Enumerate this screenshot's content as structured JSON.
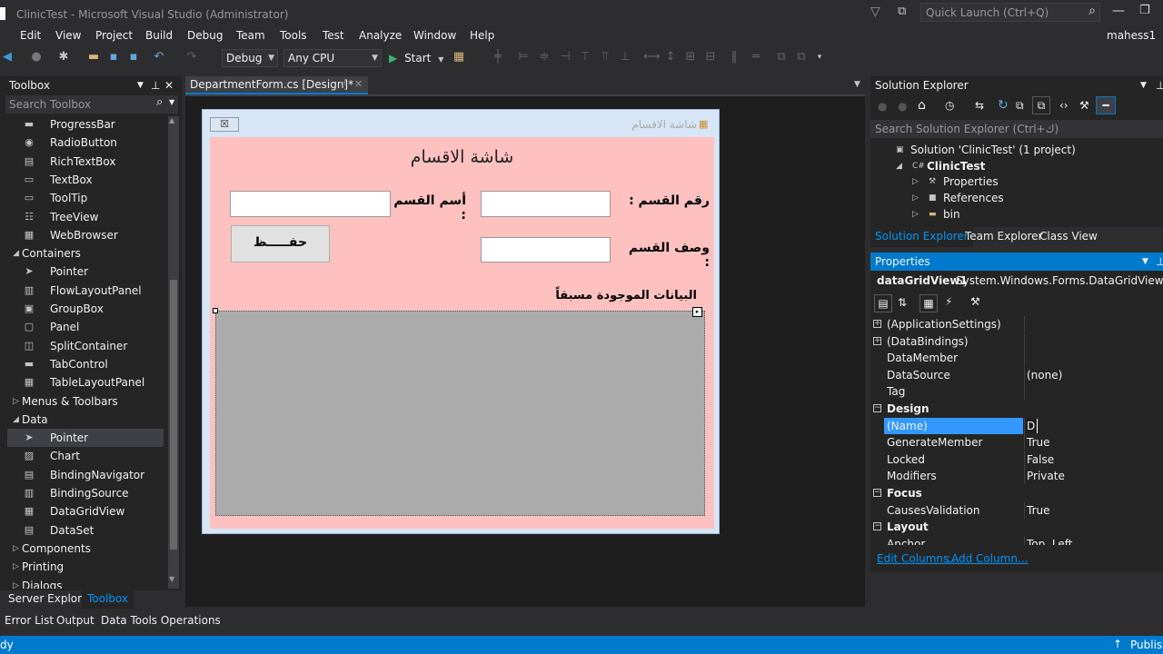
{
  "window": {
    "title": "ClinicTest - Microsoft Visual Studio (Administrator)",
    "quick_launch": "Quick Launch (Ctrl+Q)",
    "user": "mahess1"
  },
  "menu": [
    "Edit",
    "View",
    "Project",
    "Build",
    "Debug",
    "Team",
    "Tools",
    "Test",
    "Analyze",
    "Window",
    "Help"
  ],
  "toolbar": {
    "config": "Debug",
    "platform": "Any CPU",
    "start": "Start"
  },
  "toolbox": {
    "title": "Toolbox",
    "search_placeholder": "Search Toolbox",
    "items": [
      {
        "label": "ProgressBar",
        "kind": "item",
        "icon": "progressbar-icon"
      },
      {
        "label": "RadioButton",
        "kind": "item",
        "icon": "radiobutton-icon"
      },
      {
        "label": "RichTextBox",
        "kind": "item",
        "icon": "richtextbox-icon"
      },
      {
        "label": "TextBox",
        "kind": "item",
        "icon": "textbox-icon"
      },
      {
        "label": "ToolTip",
        "kind": "item",
        "icon": "tooltip-icon"
      },
      {
        "label": "TreeView",
        "kind": "item",
        "icon": "treeview-icon"
      },
      {
        "label": "WebBrowser",
        "kind": "item",
        "icon": "webbrowser-icon"
      },
      {
        "label": "Containers",
        "kind": "cat-open"
      },
      {
        "label": "Pointer",
        "kind": "item",
        "icon": "pointer-icon"
      },
      {
        "label": "FlowLayoutPanel",
        "kind": "item",
        "icon": "flowlayoutpanel-icon"
      },
      {
        "label": "GroupBox",
        "kind": "item",
        "icon": "groupbox-icon"
      },
      {
        "label": "Panel",
        "kind": "item",
        "icon": "panel-icon"
      },
      {
        "label": "SplitContainer",
        "kind": "item",
        "icon": "splitcontainer-icon"
      },
      {
        "label": "TabControl",
        "kind": "item",
        "icon": "tabcontrol-icon"
      },
      {
        "label": "TableLayoutPanel",
        "kind": "item",
        "icon": "tablelayoutpanel-icon"
      },
      {
        "label": "Menus & Toolbars",
        "kind": "cat-closed"
      },
      {
        "label": "Data",
        "kind": "cat-open"
      },
      {
        "label": "Pointer",
        "kind": "item",
        "icon": "pointer-icon",
        "selected": true
      },
      {
        "label": "Chart",
        "kind": "item",
        "icon": "chart-icon"
      },
      {
        "label": "BindingNavigator",
        "kind": "item",
        "icon": "bindingnavigator-icon"
      },
      {
        "label": "BindingSource",
        "kind": "item",
        "icon": "bindingsource-icon"
      },
      {
        "label": "DataGridView",
        "kind": "item",
        "icon": "datagridview-icon"
      },
      {
        "label": "DataSet",
        "kind": "item",
        "icon": "dataset-icon"
      },
      {
        "label": "Components",
        "kind": "cat-closed"
      },
      {
        "label": "Printing",
        "kind": "cat-closed"
      },
      {
        "label": "Dialogs",
        "kind": "cat-closed"
      }
    ],
    "bottom_tabs": [
      "Server Explorer",
      "Toolbox"
    ]
  },
  "editor": {
    "tab_label": "DepartmentForm.cs [Design]*",
    "form": {
      "caption": "شاشة الاقسام",
      "heading": "شاشة الاقسام",
      "label_dept_no": "رقم القسم :",
      "label_dept_name": "أسم القسم :",
      "label_dept_desc": "وصف القسم :",
      "save_button": "حفـــــظ",
      "existing_data_label": "البيانات الموجودة مسبقاً"
    }
  },
  "solution_explorer": {
    "title": "Solution Explorer",
    "search_placeholder": "Search Solution Explorer (Ctrl+ك)",
    "nodes": [
      {
        "label": "Solution 'ClinicTest' (1 project)",
        "indent": 0,
        "icon": "solution-icon"
      },
      {
        "label": "ClinicTest",
        "indent": 1,
        "icon": "csharp-project-icon",
        "bold": true,
        "arrow": "open"
      },
      {
        "label": "Properties",
        "indent": 2,
        "icon": "wrench-icon",
        "arrow": "closed"
      },
      {
        "label": "References",
        "indent": 2,
        "icon": "references-icon",
        "arrow": "closed"
      },
      {
        "label": "bin",
        "indent": 2,
        "icon": "folder-icon",
        "arrow": "closed"
      }
    ],
    "tabs": [
      "Solution Explorer",
      "Team Explorer",
      "Class View"
    ]
  },
  "properties": {
    "title": "Properties",
    "object_name": "dataGridView1",
    "object_type": "System.Windows.Forms.DataGridView",
    "rows": [
      {
        "key": "(ApplicationSettings)",
        "value": "",
        "type": "expand"
      },
      {
        "key": "(DataBindings)",
        "value": "",
        "type": "expand"
      },
      {
        "key": "DataMember",
        "value": "",
        "type": "prop"
      },
      {
        "key": "DataSource",
        "value": "(none)",
        "type": "prop"
      },
      {
        "key": "Tag",
        "value": "",
        "type": "prop"
      },
      {
        "key": "Design",
        "value": "",
        "type": "cat"
      },
      {
        "key": "(Name)",
        "value": "D",
        "type": "prop",
        "selected": true
      },
      {
        "key": "GenerateMember",
        "value": "True",
        "type": "prop"
      },
      {
        "key": "Locked",
        "value": "False",
        "type": "prop"
      },
      {
        "key": "Modifiers",
        "value": "Private",
        "type": "prop"
      },
      {
        "key": "Focus",
        "value": "",
        "type": "cat"
      },
      {
        "key": "CausesValidation",
        "value": "True",
        "type": "prop"
      },
      {
        "key": "Layout",
        "value": "",
        "type": "cat"
      },
      {
        "key": "Anchor",
        "value": "Top, Left",
        "type": "prop"
      }
    ],
    "link_edit_columns": "Edit Columns...",
    "link_add_column": "Add Column..."
  },
  "bottom_tabs": [
    "Error List",
    "Output",
    "Data Tools Operations"
  ],
  "status": {
    "left": "dy",
    "right": "Publish"
  },
  "colors": {
    "accent": "#007acc",
    "form_bg": "#ffc0c0",
    "grid_bg": "#ababab",
    "selection": "#3399ff"
  }
}
